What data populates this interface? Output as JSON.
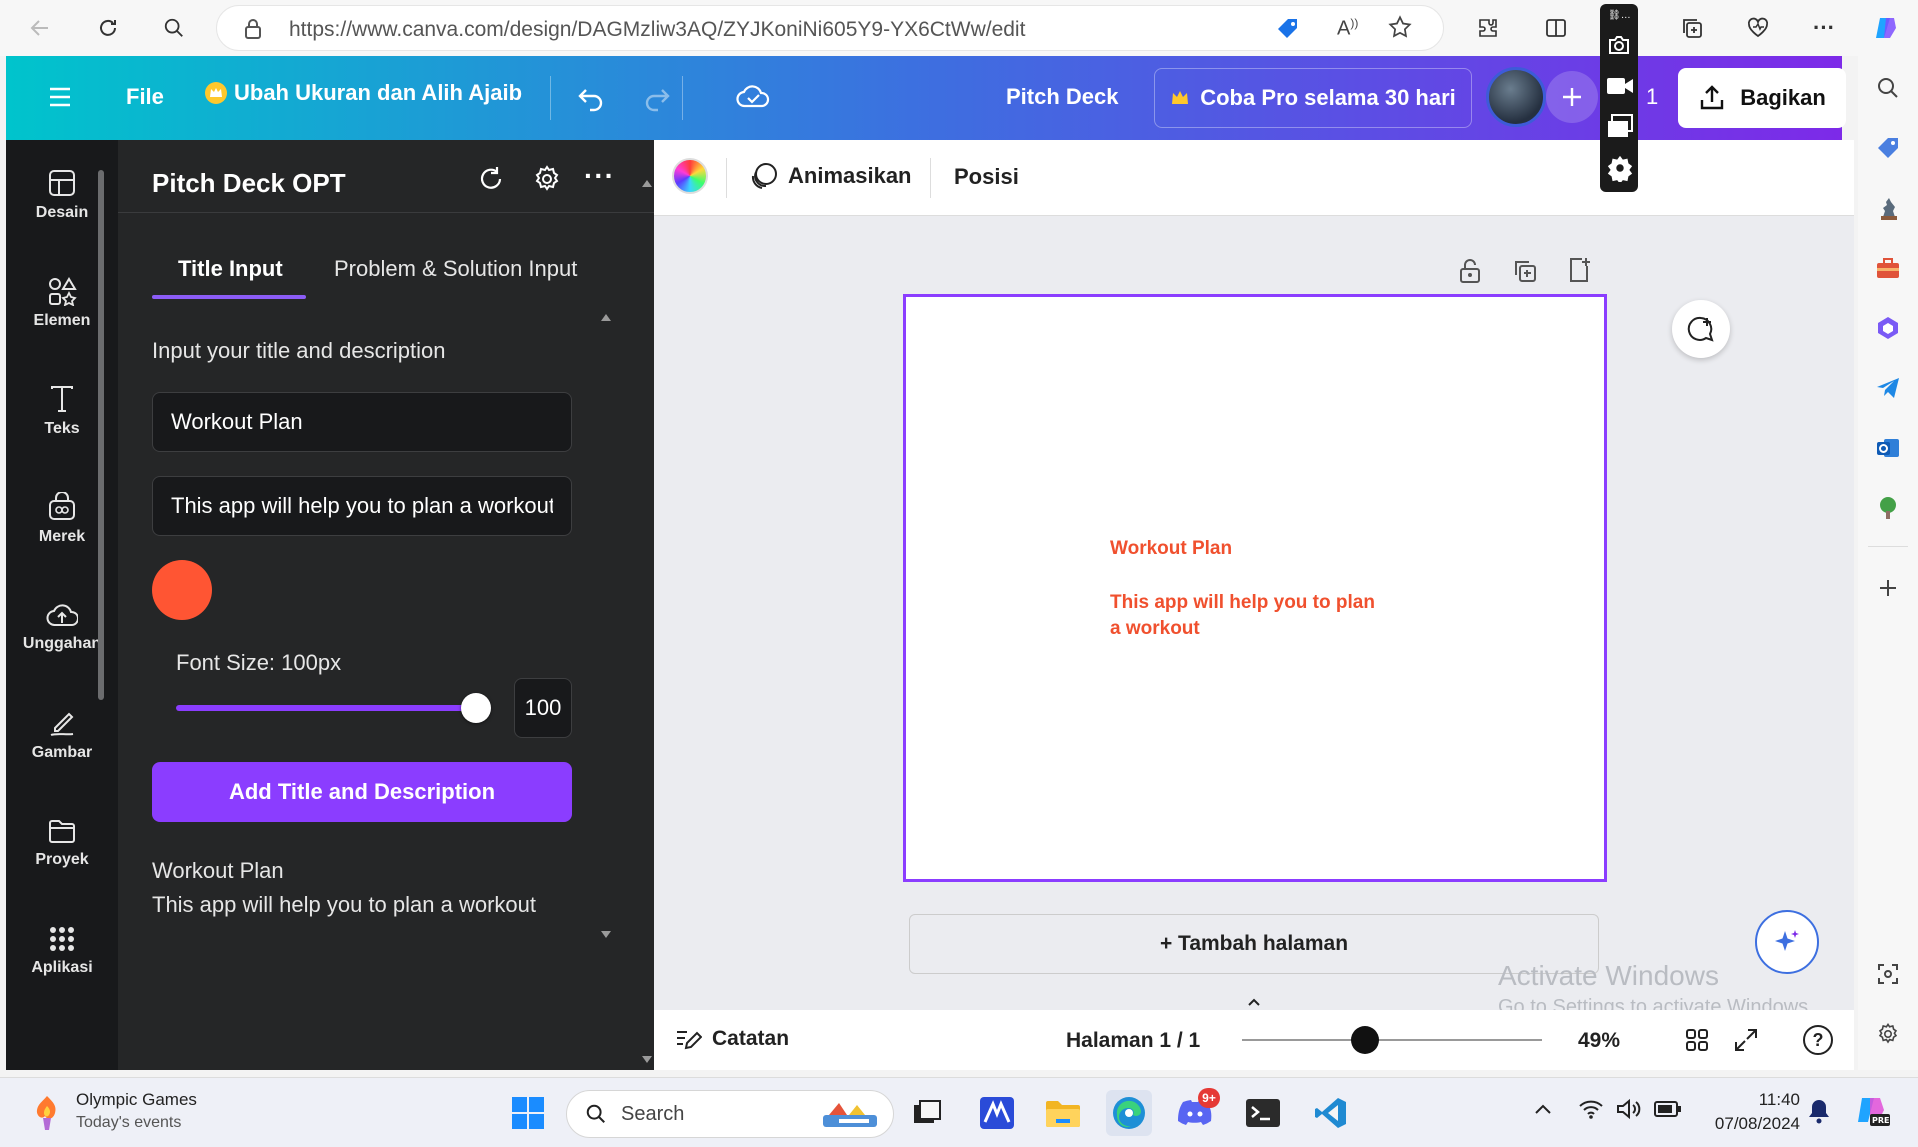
{
  "browser": {
    "url": "https://www.canva.com/design/DAGMzliw3AQ/ZYJKoniNi605Y9-YX6CtWw/edit"
  },
  "header": {
    "file_label": "File",
    "magic_resize_label": "Ubah Ukuran dan Alih Ajaib",
    "doc_title": "Pitch Deck",
    "try_pro_label": "Coba Pro selama 30 hari",
    "collaborator_count": "1",
    "share_label": "Bagikan"
  },
  "rail": {
    "items": [
      {
        "label": "Desain",
        "icon": "layout-icon"
      },
      {
        "label": "Elemen",
        "icon": "shapes-icon"
      },
      {
        "label": "Teks",
        "icon": "text-icon"
      },
      {
        "label": "Merek",
        "icon": "brand-icon"
      },
      {
        "label": "Unggahan",
        "icon": "upload-cloud-icon"
      },
      {
        "label": "Gambar",
        "icon": "draw-icon"
      },
      {
        "label": "Proyek",
        "icon": "folder-icon"
      },
      {
        "label": "Aplikasi",
        "icon": "apps-grid-icon"
      }
    ]
  },
  "panel": {
    "title": "Pitch Deck OPT",
    "tabs": [
      "Title Input",
      "Problem & Solution Input"
    ],
    "active_tab": "Title Input",
    "section_label": "Input your title and description",
    "title_value": "Workout Plan",
    "description_value": "This app will help you to plan a workout",
    "color": "#ff5533",
    "font_size_label": "Font Size: 100px",
    "font_size_value": "100",
    "slider_percent": 100,
    "add_button_label": "Add Title and Description",
    "preview_title": "Workout Plan",
    "preview_description": "This app will help you to plan a workout"
  },
  "context_toolbar": {
    "animate_label": "Animasikan",
    "position_label": "Posisi"
  },
  "canvas": {
    "title": "Workout Plan",
    "description_line1": "This app will help you to plan",
    "description_line2": "a workout",
    "text_color": "#f0502e",
    "add_page_label": "+ Tambah halaman"
  },
  "watermark": {
    "line1": "Activate Windows",
    "line2": "Go to Settings to activate Windows."
  },
  "bottom_bar": {
    "notes_label": "Catatan",
    "page_label": "Halaman 1 / 1",
    "zoom_label": "49%",
    "zoom_fraction": 0.41
  },
  "taskbar": {
    "news_title": "Olympic Games",
    "news_subtitle": "Today's events",
    "search_placeholder": "Search",
    "time": "11:40",
    "date": "07/08/2024",
    "discord_badge": "9+"
  },
  "colors": {
    "accent": "#8b3dff",
    "panel_bg": "#252627",
    "rail_bg": "#18191b"
  }
}
